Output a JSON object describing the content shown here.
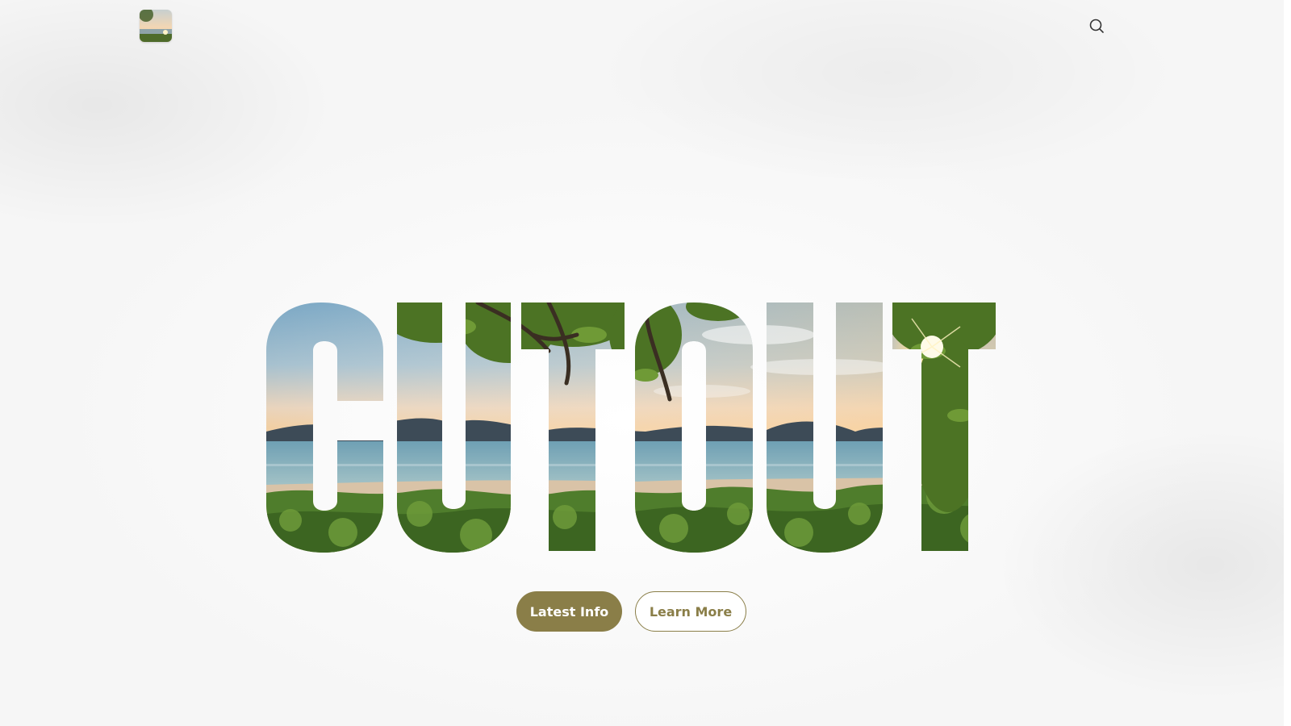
{
  "header": {
    "logo_icon": "beach-thumbnail-logo",
    "search_icon": "search-icon"
  },
  "hero": {
    "headline": "CUTOUT",
    "image_description_icon": "beach-landscape-image"
  },
  "actions": {
    "primary_label": "Latest Info",
    "secondary_label": "Learn More"
  },
  "colors": {
    "accent": "#8a7e48",
    "background": "#f4f4f4"
  }
}
